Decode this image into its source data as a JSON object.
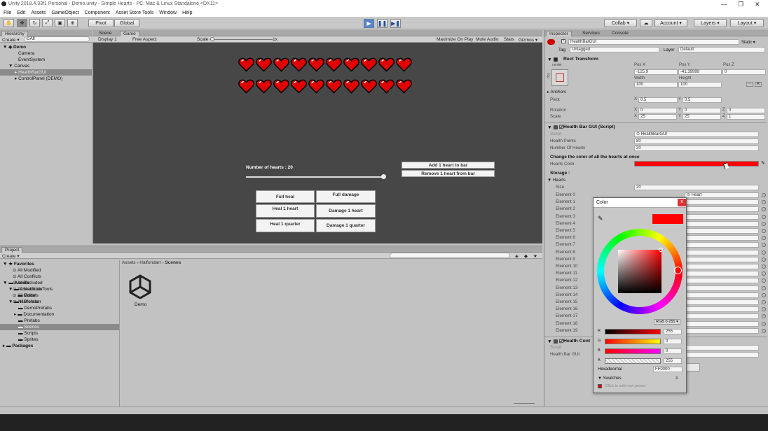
{
  "window": {
    "title": "Unity 2018.4.33f1 Personal - Demo.unity - Simple Hearts - PC, Mac & Linux Standalone <DX11>",
    "controls": [
      "—",
      "❐",
      "✕"
    ]
  },
  "menu": [
    "File",
    "Edit",
    "Assets",
    "GameObject",
    "Component",
    "Asset Store Tools",
    "Window",
    "Help"
  ],
  "toolbar": {
    "pivot": "Pivot",
    "global": "Global",
    "collab": "Collab ▾",
    "account": "Account ▾",
    "layers": "Layers ▾",
    "layout": "Layout ▾"
  },
  "hierarchy": {
    "tab": "Hierarchy",
    "create": "Create ▾",
    "search": "⊙All",
    "scene": "Demo",
    "items": [
      "Camera",
      "EventSystem",
      "Canvas",
      "HealthBarGUI",
      "ControlPanel (DEMO)"
    ]
  },
  "center_tabs": {
    "scene": "Scene",
    "game": "Game"
  },
  "game_bar": {
    "display": "Display 1",
    "aspect": "Free Aspect",
    "scale_label": "Scale",
    "scale_value": "1x",
    "maximize": "Maximize On Play",
    "mute": "Mute Audio",
    "stats": "Stats",
    "gizmos": "Gizmos ▾"
  },
  "game": {
    "hearts_row1": 10,
    "hearts_row2": 10,
    "heart_color": "#e00000",
    "count_label": "Number of hearts : 20",
    "slider_fraction": 1.0,
    "buttons": {
      "add": "Add 1 heart to bar",
      "remove": "Remove 1 heart from bar",
      "full_heal": "Full heal",
      "full_damage": "Full damage",
      "heal_1": "Heal 1 heart",
      "damage_1": "Damage 1 heart",
      "heal_q": "Heal 1 quarter",
      "damage_q": "Damage 1 quarter"
    }
  },
  "project": {
    "tab": "Project",
    "create": "Create ▾",
    "favorites": "Favorites",
    "fav_items": [
      "All Modified",
      "All Conflicts",
      "All Excluded",
      "All Materials",
      "All Models",
      "All Prefabs"
    ],
    "assets": "Assets",
    "asset_items": [
      "AssetStoreTools",
      "Editor",
      "Halfondarr",
      "DemoPrefabs",
      "Documentation",
      "Prefabs",
      "Scenes",
      "Scripts",
      "Sprites"
    ],
    "packages": "Packages",
    "breadcrumb": [
      "Assets",
      "Halfondarr",
      "Scenes"
    ],
    "file": "Demo"
  },
  "inspector": {
    "tabs": [
      "Inspector",
      "Services",
      "Console"
    ],
    "object_name": "HealthBarGUI",
    "static": "Static ▾",
    "tag_label": "Tag",
    "tag_value": "Untagged",
    "layer_label": "Layer",
    "layer_value": "Default",
    "rect": {
      "title": "Rect Transform",
      "anchor": "center",
      "side": "top",
      "posx_label": "Pos X",
      "posy_label": "Pos Y",
      "posz_label": "Pos Z",
      "posx": "-125.9",
      "posy": "-41.39999",
      "posz": "0",
      "width_label": "Width",
      "height_label": "Height",
      "width": "100",
      "height": "100",
      "anchors": "Anchors",
      "pivot": "Pivot",
      "pivot_x": "0.5",
      "pivot_y": "0.5",
      "rotation": "Rotation",
      "rot_x": "0",
      "rot_y": "0",
      "rot_z": "0",
      "scale": "Scale",
      "scale_x": "25",
      "scale_y": "25",
      "scale_z": "1",
      "x": "X",
      "y": "Y",
      "z": "Z"
    },
    "script": {
      "title": "Health Bar GUI (Script)",
      "script_label": "Script",
      "script_value": "⊙ HealthBarGUI",
      "hp_label": "Health Points",
      "hp_value": "80",
      "noh_label": "Number Of Hearts",
      "noh_value": "20",
      "change_label": "Change the color of all the hearts at once",
      "color_label": "Hearts Color",
      "color": "#ff0000",
      "storage": "Storage :",
      "hearts": "Hearts",
      "size_label": "Size",
      "size_value": "20",
      "element0_value": "⊙ Heart"
    },
    "elements": [
      "Element 0",
      "Element 1",
      "Element 2",
      "Element 3",
      "Element 4",
      "Element 5",
      "Element 6",
      "Element 7",
      "Element 8",
      "Element 9",
      "Element 10",
      "Element 11",
      "Element 12",
      "Element 13",
      "Element 14",
      "Element 15",
      "Element 16",
      "Element 17",
      "Element 18",
      "Element 19"
    ],
    "health_cont": {
      "title": "Health Cont",
      "script_label": "Script",
      "hbg_label": "Health Bar GUI"
    }
  },
  "color_picker": {
    "title": "Color",
    "mode": "RGB 0-255 ▾",
    "r_label": "R",
    "g_label": "G",
    "b_label": "B",
    "a_label": "A",
    "r": "255",
    "g": "0",
    "b": "0",
    "a": "255",
    "hex_label": "Hexadecimal",
    "hex": "FF0000",
    "swatches": "▼ Swatches",
    "hint": "Click to add new preset",
    "close": "x"
  }
}
